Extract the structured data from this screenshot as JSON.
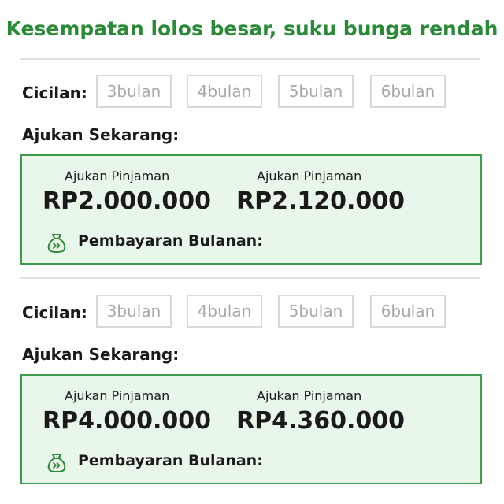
{
  "headline": "Kesempatan lolos besar, suku bunga rendah",
  "colors": {
    "accent": "#2a8a37",
    "card_background": "#e9f6ea",
    "card_border": "#3e9b4b",
    "tenor_border": "#d9d9d9",
    "tenor_text": "#a9a9a9"
  },
  "offers": [
    {
      "cicilan_label": "Cicilan:",
      "tenors": [
        "3bulan",
        "4bulan",
        "5bulan",
        "6bulan"
      ],
      "ajukan_heading": "Ajukan Sekarang:",
      "card": {
        "left_label": "Ajukan Pinjaman",
        "left_amount": "RP2.000.000",
        "right_label": "Ajukan Pinjaman",
        "right_amount": "RP2.120.000",
        "payment_icon": "money-bag-icon",
        "payment_label": "Pembayaran Bulanan:"
      }
    },
    {
      "cicilan_label": "Cicilan:",
      "tenors": [
        "3bulan",
        "4bulan",
        "5bulan",
        "6bulan"
      ],
      "ajukan_heading": "Ajukan Sekarang:",
      "card": {
        "left_label": "Ajukan Pinjaman",
        "left_amount": "RP4.000.000",
        "right_label": "Ajukan Pinjaman",
        "right_amount": "RP4.360.000",
        "payment_icon": "money-bag-icon",
        "payment_label": "Pembayaran Bulanan:"
      }
    }
  ]
}
